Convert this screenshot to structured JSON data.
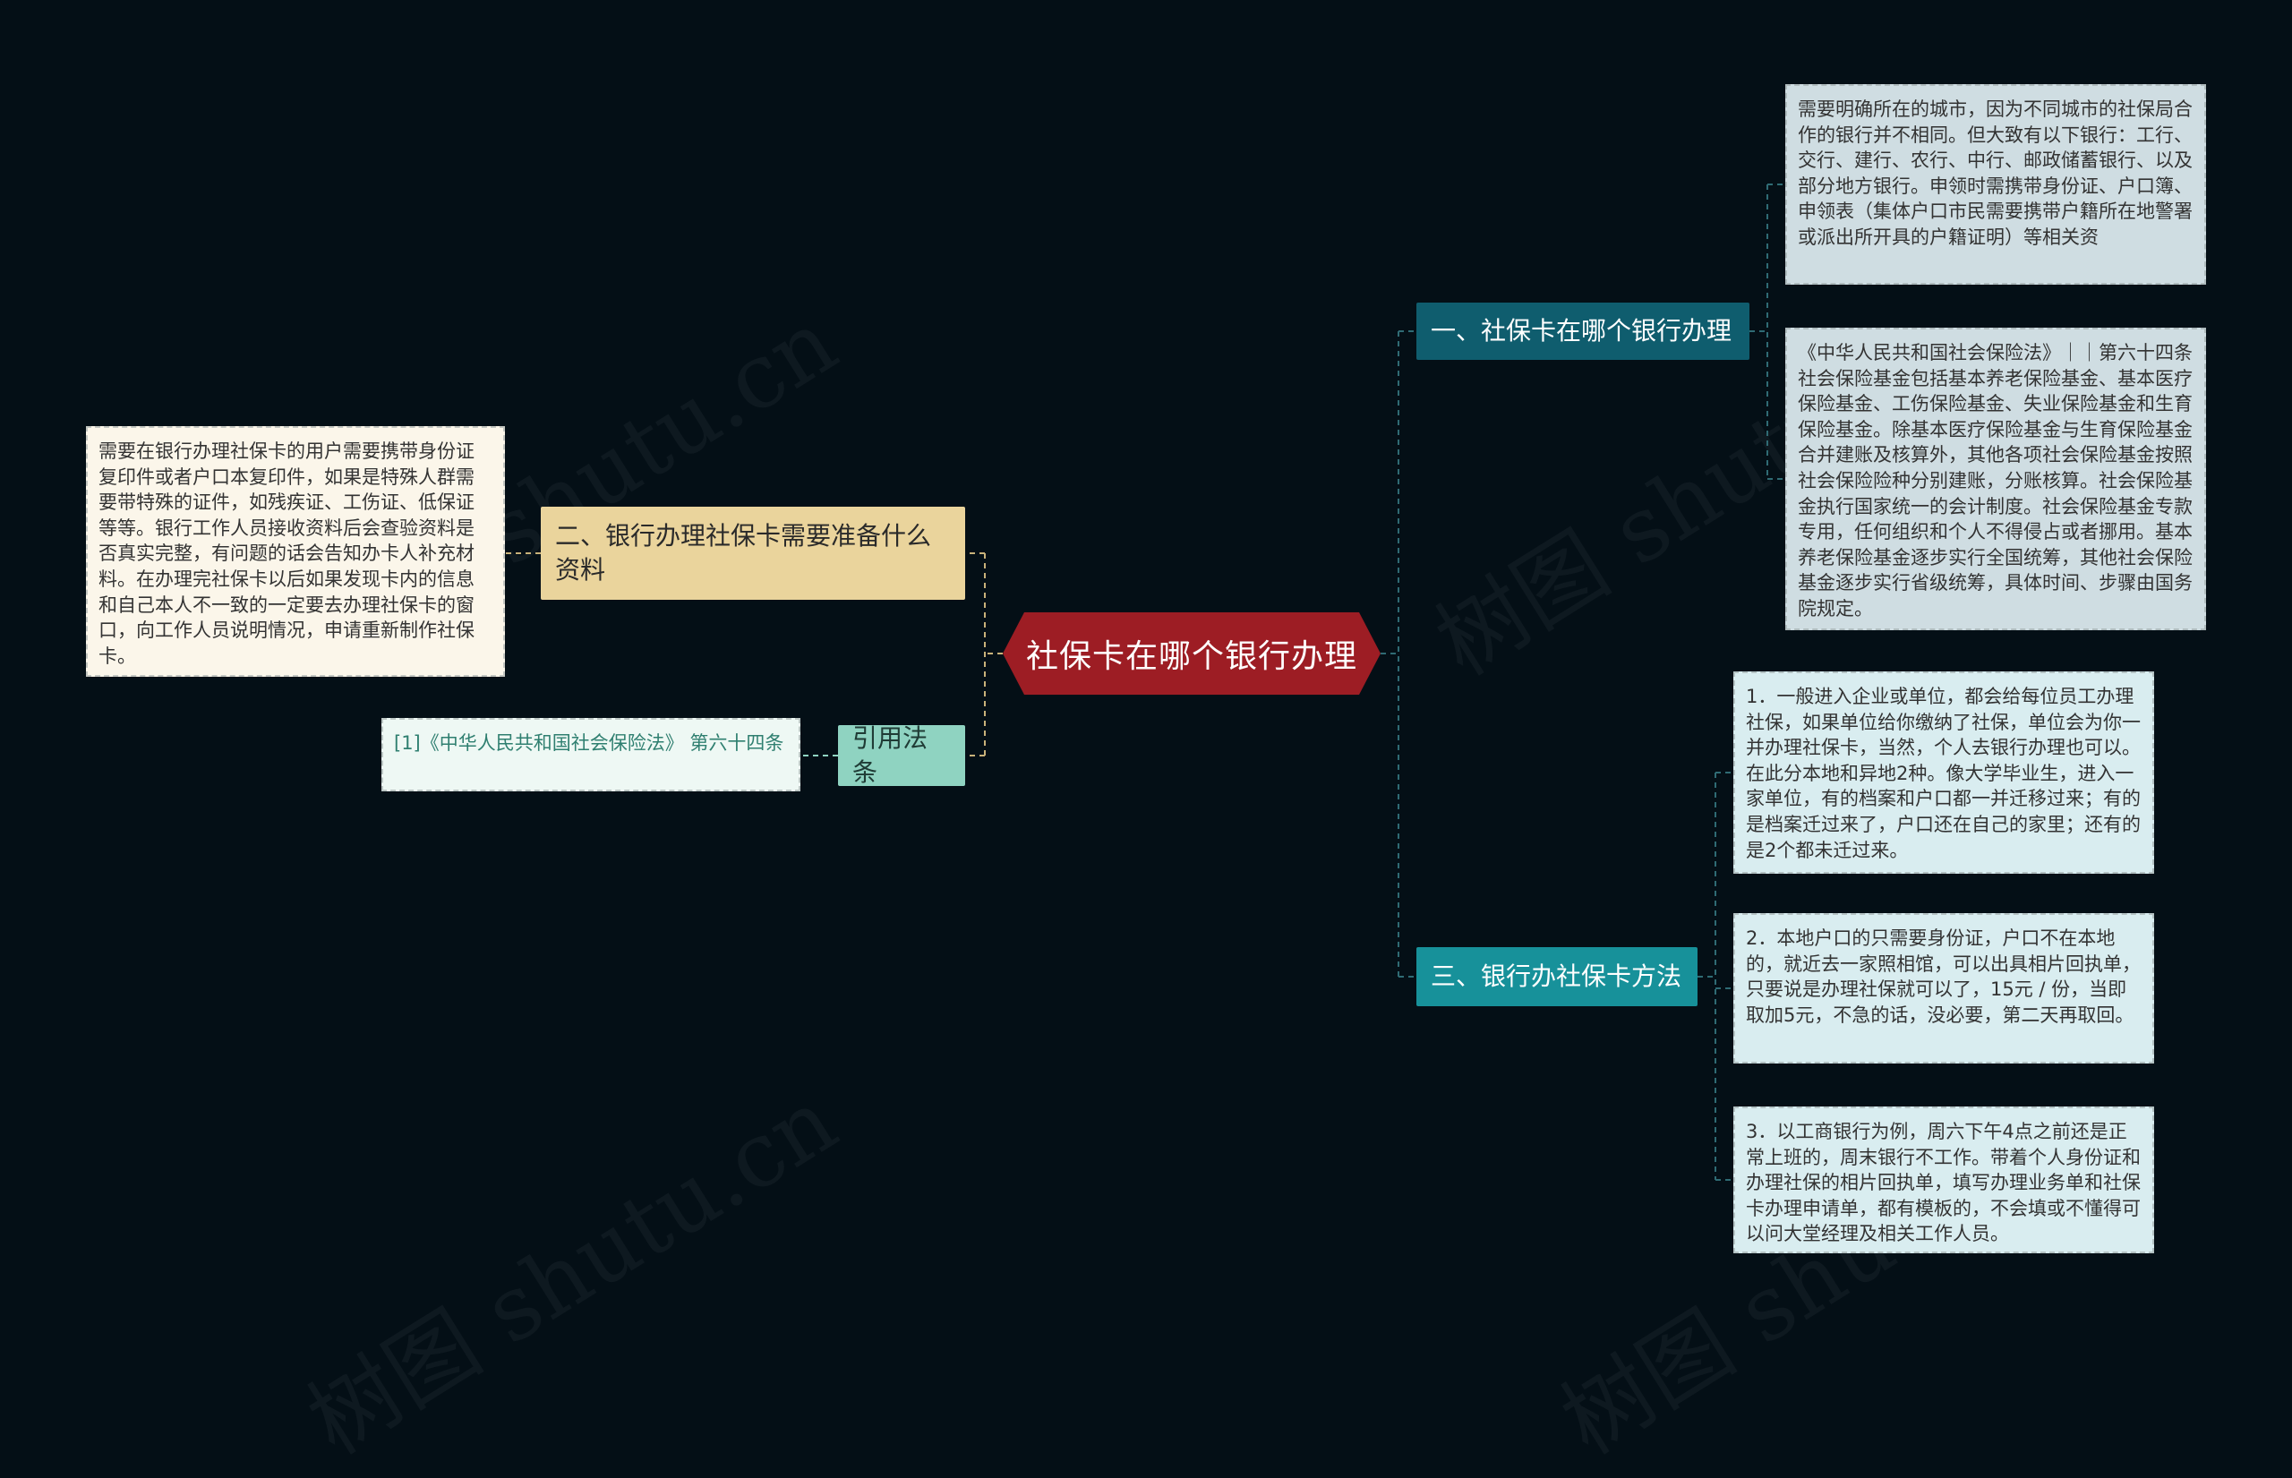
{
  "watermark": "树图 shutu.cn",
  "root": {
    "label": "社保卡在哪个银行办理"
  },
  "branches": {
    "b1": {
      "label": "一、社保卡在哪个银行办理"
    },
    "b2": {
      "label": "二、银行办理社保卡需要准备什么资料"
    },
    "b3": {
      "label": "三、银行办社保卡方法"
    },
    "cite": {
      "label": "引用法条"
    }
  },
  "leaves": {
    "b1_1": "需要明确所在的城市，因为不同城市的社保局合作的银行并不相同。但大致有以下银行：工行、交行、建行、农行、中行、邮政储蓄银行、以及部分地方银行。申领时需携带身份证、户口簿、申领表（集体户口市民需要携带户籍所在地警署或派出所开具的户籍证明）等相关资",
    "b1_2": "《中华人民共和国社会保险法》｜｜第六十四条社会保险基金包括基本养老保险基金、基本医疗保险基金、工伤保险基金、失业保险基金和生育保险基金。除基本医疗保险基金与生育保险基金合并建账及核算外，其他各项社会保险基金按照社会保险险种分别建账，分账核算。社会保险基金执行国家统一的会计制度。社会保险基金专款专用，任何组织和个人不得侵占或者挪用。基本养老保险基金逐步实行全国统筹，其他社会保险基金逐步实行省级统筹，具体时间、步骤由国务院规定。",
    "b2_1": "需要在银行办理社保卡的用户需要携带身份证复印件或者户口本复印件，如果是特殊人群需要带特殊的证件，如残疾证、工伤证、低保证等等。银行工作人员接收资料后会查验资料是否真实完整，有问题的话会告知办卡人补充材料。在办理完社保卡以后如果发现卡内的信息和自己本人不一致的一定要去办理社保卡的窗口，向工作人员说明情况，申请重新制作社保卡。",
    "cite_1": "[1]《中华人民共和国社会保险法》 第六十四条",
    "b3_1": "1．一般进入企业或单位，都会给每位员工办理社保，如果单位给你缴纳了社保，单位会为你一并办理社保卡，当然，个人去银行办理也可以。在此分本地和异地2种。像大学毕业生，进入一家单位，有的档案和户口都一并迁移过来；有的是档案迁过来了，户口还在自己的家里；还有的是2个都未迁过来。",
    "b3_2": "2．本地户口的只需要身份证，户口不在本地的，就近去一家照相馆，可以出具相片回执单，只要说是办理社保就可以了，15元 / 份，当即取加5元，不急的话，没必要，第二天再取回。",
    "b3_3": "3．以工商银行为例，周六下午4点之前还是正常上班的，周末银行不工作。带着个人身份证和办理社保的相片回执单，填写办理业务单和社保卡办理申请单，都有模板的，不会填或不懂得可以问大堂经理及相关工作人员。"
  },
  "colors": {
    "background": "#040f16",
    "root": "#9d1d24",
    "branch_left": "#ead49c",
    "branch_cite": "#8fd3c1",
    "branch_r1": "#0f5d6e",
    "branch_r3": "#17919a",
    "link_right": "#2f6b74",
    "link_left": "#c9b27a"
  }
}
